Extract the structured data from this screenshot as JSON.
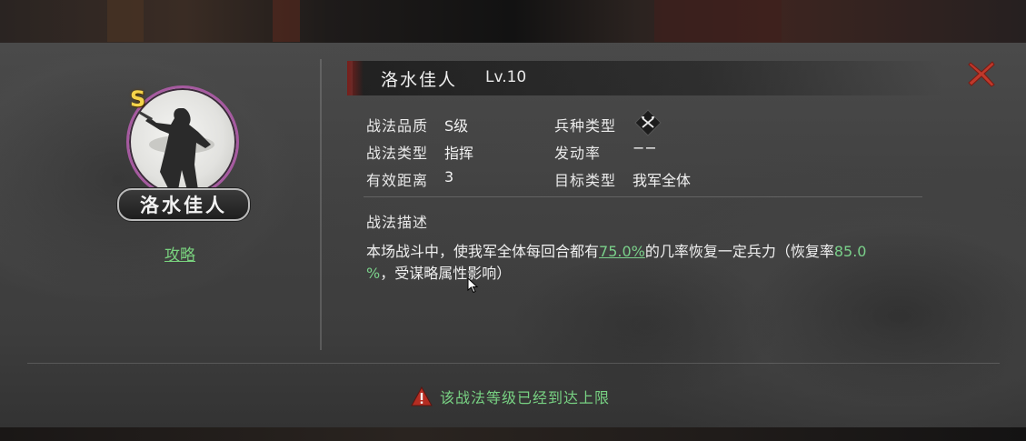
{
  "tactic": {
    "name": "洛水佳人",
    "level": "Lv.10",
    "grade_badge": "S",
    "guide_link": "攻略"
  },
  "attributes": {
    "quality_label": "战法品质",
    "quality_value": "S级",
    "type_label": "战法类型",
    "type_value": "指挥",
    "range_label": "有效距离",
    "range_value": "3",
    "troop_label": "兵种类型",
    "troop_icon": "crossed-weapons-icon",
    "trigger_label": "发动率",
    "trigger_value": "−−",
    "target_label": "目标类型",
    "target_value": "我军全体"
  },
  "description": {
    "title": "战法描述",
    "part1": "本场战斗中，使我军全体每回合都有",
    "rate": "75.0%",
    "part2": "的几率恢复一定兵力（恢复率",
    "recovery_a": "85.0",
    "recovery_b": "%",
    "part3": "，受谋略属性影响）"
  },
  "footer": {
    "warning_text": "该战法等级已经到达上限"
  },
  "icons": {
    "close": "close-icon",
    "warning": "warning-icon"
  },
  "colors": {
    "highlight_green": "#7ad08a",
    "close_red": "#c0392b",
    "portrait_ring": "#a65aa0",
    "badge_gold": "#f4d34a"
  }
}
